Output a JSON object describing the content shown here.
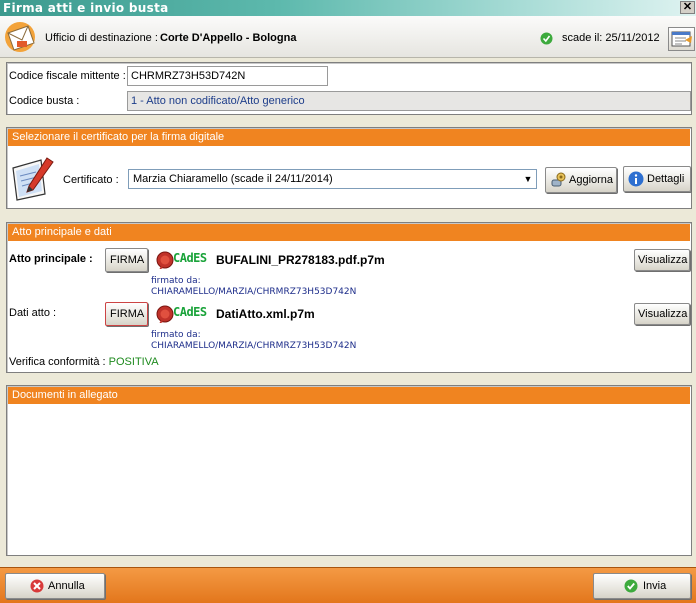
{
  "window": {
    "title": "Firma atti e invio busta",
    "close": "✕"
  },
  "header": {
    "ufficio_label": "Ufficio di destinazione :",
    "ufficio_value": "Corte D'Appello - Bologna",
    "scade": "scade il: 25/11/2012"
  },
  "mittente": {
    "codice_fiscale_label": "Codice fiscale mittente :",
    "codice_fiscale_value": "CHRMRZ73H53D742N",
    "codice_busta_label": "Codice  busta :",
    "codice_busta_value": "1 - Atto non codificato/Atto generico"
  },
  "certificato": {
    "section_title": "Selezionare il certificato per la firma digitale",
    "label": "Certificato :",
    "selected": "Marzia Chiaramello (scade il 24/11/2014)",
    "aggiorna_label": "Aggiorna",
    "dettagli_label": "Dettagli"
  },
  "atto": {
    "section_title": "Atto principale e dati",
    "principale_label": "Atto principale :",
    "principale_file": "BUFALINI_PR278183.pdf.p7m",
    "dati_label": "Dati atto :",
    "dati_file": "DatiAtto.xml.p7m",
    "firma_label": "FIRMA",
    "cades_label": "CAdES",
    "firmato_da_label": "firmato da:",
    "firmato_da_value": "CHIARAMELLO/MARZIA/CHRMRZ73H53D742N",
    "visualizza_label": "Visualizza",
    "verifica_label": "Verifica conformità :",
    "verifica_value": "POSITIVA"
  },
  "allegati": {
    "section_title": "Documenti in allegato"
  },
  "footer": {
    "annulla_label": "Annulla",
    "invia_label": "Invia"
  },
  "colors": {
    "accent": "#f08420",
    "ok": "#1e8a1e",
    "cades": "#1aa33a",
    "link": "#1d3d8a"
  },
  "icons": [
    "envelope-icon",
    "check-icon",
    "calendar-icon",
    "certificate-icon",
    "refresh-icon",
    "info-icon",
    "seal-icon",
    "cancel-icon",
    "ok-icon"
  ]
}
